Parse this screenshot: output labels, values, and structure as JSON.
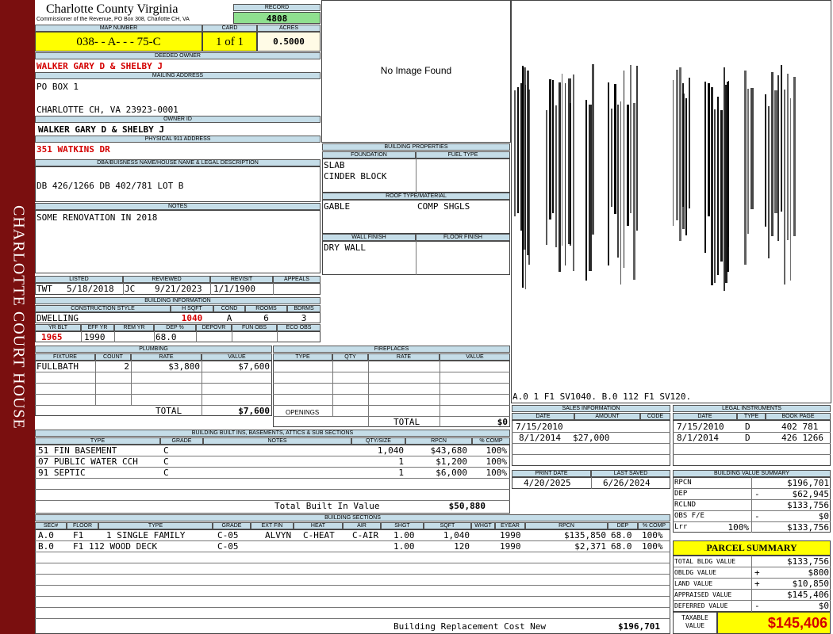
{
  "sidebar": {
    "label": "CHARLOTTE COURT HOUSE"
  },
  "header": {
    "county": "Charlotte County Virginia",
    "commissioner": "Commissioner of the Revenue, PO Box 308, Charlotte CH, VA",
    "record_label": "RECORD",
    "record": "4808",
    "map_number_label": "MAP NUMBER",
    "map_number": "038-  - A-  -  - 75-C",
    "card_label": "CARD",
    "card": "1 of 1",
    "acres_label": "ACRES",
    "acres": "0.5000"
  },
  "owner": {
    "deeded_owner_label": "DEEDED OWNER",
    "deeded_owner": "WALKER GARY D & SHELBY J",
    "mailing_label": "MAILING ADDRESS",
    "mailing_line1": "PO BOX 1",
    "mailing_line2": "CHARLOTTE CH, VA 23923-0001",
    "owner_id_label": "OWNER ID",
    "owner_id": "WALKER GARY D & SHELBY J",
    "address_label": "PHYSICAL 911 ADDRESS",
    "address": "351 WATKINS DR",
    "legal_label": "DBA/BUISNESS NAME/HOUSE NAME & LEGAL DESCRIPTION",
    "legal": "DB 426/1266 DB 402/781 LOT B",
    "notes_label": "NOTES",
    "notes": "SOME RENOVATION IN 2018"
  },
  "photo": {
    "text": "No Image Found"
  },
  "building_properties": {
    "title": "BUILDING PROPERTIES",
    "foundation_label": "FOUNDATION",
    "fuel_label": "FUEL TYPE",
    "foundation_1": "SLAB",
    "foundation_2": "CINDER BLOCK",
    "roof_label": "ROOF TYPE/MATERIAL",
    "roof_type": "GABLE",
    "roof_material": "COMP SHGLS",
    "wall_label": "WALL FINISH",
    "floor_label": "FLOOR FINISH",
    "wall": "DRY WALL"
  },
  "sketch": {
    "caption": "A.0  1    F1  SV1040.   B.0  112  F1  SV120."
  },
  "review": {
    "listed_label": "LISTED",
    "reviewed_label": "REVIEWED",
    "revisit_label": "REVISIT",
    "appeals_label": "APPEALS",
    "listed_by": "TWT",
    "listed_date": "5/18/2018",
    "reviewed_by": "JC",
    "reviewed_date": "9/21/2023",
    "revisit": "1/1/1900"
  },
  "building_info": {
    "title": "BUILDING INFORMATION",
    "style_label": "CONSTRUCTION STYLE",
    "hsqft_label": "H SQFT",
    "cond_label": "COND",
    "rooms_label": "ROOMS",
    "bdrms_label": "BDRMS",
    "style": "DWELLING",
    "hsqft": "1040",
    "cond": "A",
    "rooms": "6",
    "bdrms": "3",
    "yrblt_label": "YR BLT",
    "effyr_label": "EFF YR",
    "remyr_label": "REM YR",
    "dep_label": "DEP %",
    "depovr_label": "DEPOVR",
    "funobs_label": "FUN OBS",
    "ecoobs_label": "ECO OBS",
    "yrblt": "1965",
    "effyr": "1990",
    "dep": "68.0"
  },
  "plumbing": {
    "title": "PLUMBING",
    "fixture_label": "FIXTURE",
    "count_label": "COUNT",
    "rate_label": "RATE",
    "value_label": "VALUE",
    "row_fixture": "FULLBATH",
    "row_count": "2",
    "row_rate": "$3,800",
    "row_value": "$7,600",
    "total_label": "TOTAL",
    "total": "$7,600"
  },
  "fireplaces": {
    "title": "FIREPLACES",
    "type_label": "TYPE",
    "qty_label": "QTY",
    "rate_label": "RATE",
    "value_label": "VALUE",
    "openings_label": "OPENINGS",
    "total_label": "TOTAL",
    "total": "$0"
  },
  "sales": {
    "title": "SALES INFORMATION",
    "date_label": "DATE",
    "amount_label": "AMOUNT",
    "code_label": "CODE",
    "rows": [
      {
        "date": "7/15/2010",
        "amount": ""
      },
      {
        "date": "8/1/2014",
        "amount": "$27,000"
      }
    ]
  },
  "legal_instruments": {
    "title": "LEGAL INSTRUMENTS",
    "date_label": "DATE",
    "type_label": "TYPE",
    "book_label": "BOOK PAGE",
    "rows": [
      {
        "date": "7/15/2010",
        "type": "D",
        "book": "402 781"
      },
      {
        "date": "8/1/2014",
        "type": "D",
        "book": "426 1266"
      }
    ]
  },
  "built_ins": {
    "title": "BUILDING BUILT INS, BASEMENTS, ATTICS & SUB SECTIONS",
    "type_label": "TYPE",
    "grade_label": "GRADE",
    "notes_label": "NOTES",
    "qty_label": "QTY/SIZE",
    "rpcn_label": "RPCN",
    "comp_label": "% COMP",
    "rows": [
      {
        "type": "51 FIN BASEMENT",
        "grade": "C",
        "qty": "1,040",
        "rpcn": "$43,680",
        "comp": "100%"
      },
      {
        "type": "07 PUBLIC WATER CCH",
        "grade": "C",
        "qty": "1",
        "rpcn": "$1,200",
        "comp": "100%"
      },
      {
        "type": "91 SEPTIC",
        "grade": "C",
        "qty": "1",
        "rpcn": "$6,000",
        "comp": "100%"
      }
    ],
    "total_label": "Total Built In Value",
    "total": "$50,880"
  },
  "print_info": {
    "print_label": "PRINT DATE",
    "saved_label": "LAST SAVED",
    "print_date": "4/20/2025",
    "saved_date": "6/26/2024"
  },
  "value_summary": {
    "title": "BUILDING VALUE SUMMARY",
    "rows": [
      {
        "label": "RPCN",
        "pct": "",
        "sign": "",
        "value": "$196,701"
      },
      {
        "label": "DEP",
        "pct": "",
        "sign": "-",
        "value": "$62,945"
      },
      {
        "label": "RCLND",
        "pct": "",
        "sign": "",
        "value": "$133,756"
      },
      {
        "label": "OBS F/E",
        "pct": "",
        "sign": "-",
        "value": "$0"
      },
      {
        "label": "Lrr",
        "pct": "100%",
        "sign": "",
        "value": "$133,756"
      }
    ]
  },
  "sections": {
    "title": "BUILDING SECTIONS",
    "headers": [
      "SEC#",
      "FLOOR",
      "TYPE",
      "GRADE",
      "EXT FIN",
      "HEAT",
      "AIR",
      "SHGT",
      "SQFT",
      "WHGT",
      "EYEAR",
      "RPCN",
      "DEP",
      "% COMP"
    ],
    "rows": [
      {
        "sec": "A.0",
        "floor": "F1",
        "type": "1 SINGLE FAMILY",
        "grade": "C-05",
        "extfin": "ALVYN",
        "heat": "C-HEAT",
        "air": "C-AIR",
        "shgt": "1.00",
        "sqft": "1,040",
        "eyear": "1990",
        "rpcn": "$135,850",
        "dep": "68.0",
        "comp": "100%"
      },
      {
        "sec": "B.0",
        "floor": "F1",
        "type": "112 WOOD DECK",
        "grade": "C-05",
        "extfin": "",
        "heat": "",
        "air": "",
        "shgt": "1.00",
        "sqft": "120",
        "eyear": "1990",
        "rpcn": "$2,371",
        "dep": "68.0",
        "comp": "100%"
      }
    ],
    "replacement_label": "Building Replacement Cost New",
    "replacement": "$196,701"
  },
  "parcel_summary": {
    "title": "PARCEL SUMMARY",
    "rows": [
      {
        "label": "TOTAL BLDG VALUE",
        "sign": "",
        "value": "$133,756"
      },
      {
        "label": "OBLDG VALUE",
        "sign": "+",
        "value": "$800"
      },
      {
        "label": "LAND VALUE",
        "sign": "+",
        "value": "$10,850"
      },
      {
        "label": "APPRAISED VALUE",
        "sign": "",
        "value": "$145,406"
      },
      {
        "label": "DEFERRED VALUE",
        "sign": "-",
        "value": "$0"
      }
    ],
    "taxable_label_1": "TAXABLE",
    "taxable_label_2": "VALUE",
    "taxable": "$145,406"
  },
  "colors": {
    "sidebar": "#7a0f0f",
    "header_blue": "#c5dde8",
    "highlight_yellow": "#ffff00",
    "record_green": "#8fe08f",
    "owner_red": "#d40000"
  }
}
